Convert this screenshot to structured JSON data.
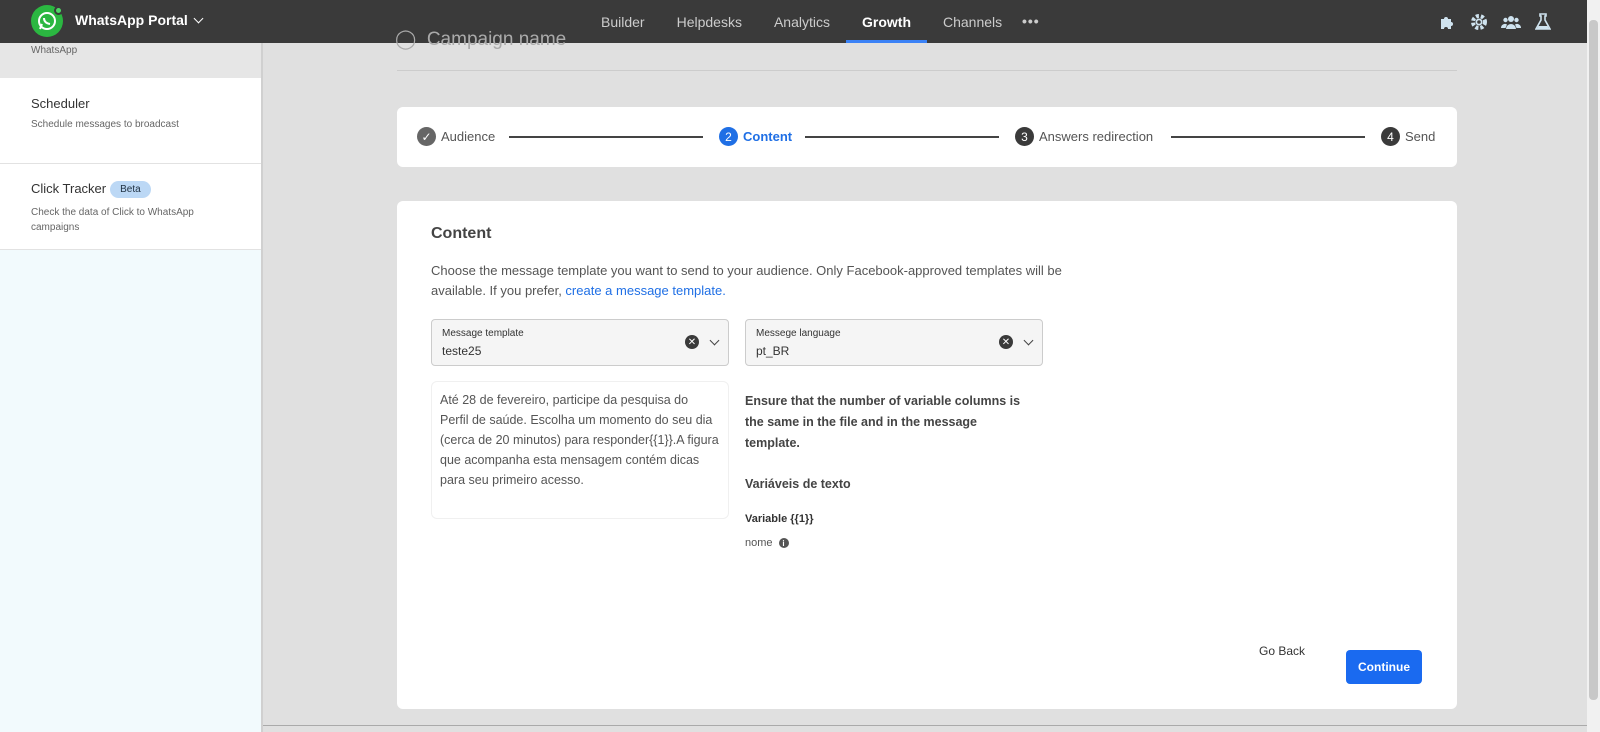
{
  "header": {
    "app_title": "WhatsApp Portal",
    "nav": [
      {
        "label": "Builder",
        "active": false
      },
      {
        "label": "Helpdesks",
        "active": false
      },
      {
        "label": "Analytics",
        "active": false
      },
      {
        "label": "Growth",
        "active": true
      },
      {
        "label": "Channels",
        "active": false
      }
    ],
    "more_label": "•••",
    "icons": [
      "puzzle-icon",
      "gear-icon",
      "users-icon",
      "flask-icon"
    ]
  },
  "sidebar": {
    "top_label": "WhatsApp",
    "items": [
      {
        "title": "Scheduler",
        "desc": "Schedule messages to broadcast"
      },
      {
        "title": "Click Tracker",
        "badge": "Beta",
        "desc": "Check the data of Click to WhatsApp campaigns"
      }
    ]
  },
  "campaign": {
    "name": "Campaign name"
  },
  "stepper": {
    "steps": [
      {
        "num": "✓",
        "label": "Audience",
        "state": "done"
      },
      {
        "num": "2",
        "label": "Content",
        "state": "active"
      },
      {
        "num": "3",
        "label": "Answers redirection",
        "state": "pending"
      },
      {
        "num": "4",
        "label": "Send",
        "state": "pending"
      }
    ]
  },
  "content": {
    "title": "Content",
    "desc": "Choose the message template you want to send to your audience. Only Facebook-approved templates will be available. If you prefer, ",
    "desc_link": "create a message template.",
    "template_field": {
      "label": "Message template",
      "value": "teste25"
    },
    "language_field": {
      "label": "Messege language",
      "value": "pt_BR"
    },
    "preview_text": "Até 28 de fevereiro, participe da pesquisa do Perfil de saúde. Escolha um momento do seu dia (cerca de 20 minutos) para responder{{1}}.A figura que acompanha esta mensagem contém dicas para seu primeiro acesso.",
    "hint": "Ensure that the number of variable columns is the same in the file and in the message template.",
    "vars_title": "Variáveis de texto",
    "variable_name": "Variable {{1}}",
    "variable_value": "nome",
    "back_label": "Go Back",
    "continue_label": "Continue"
  },
  "colors": {
    "accent": "#1f6fe5",
    "topbar": "#3a3a3a",
    "whatsapp": "#2bb741"
  }
}
